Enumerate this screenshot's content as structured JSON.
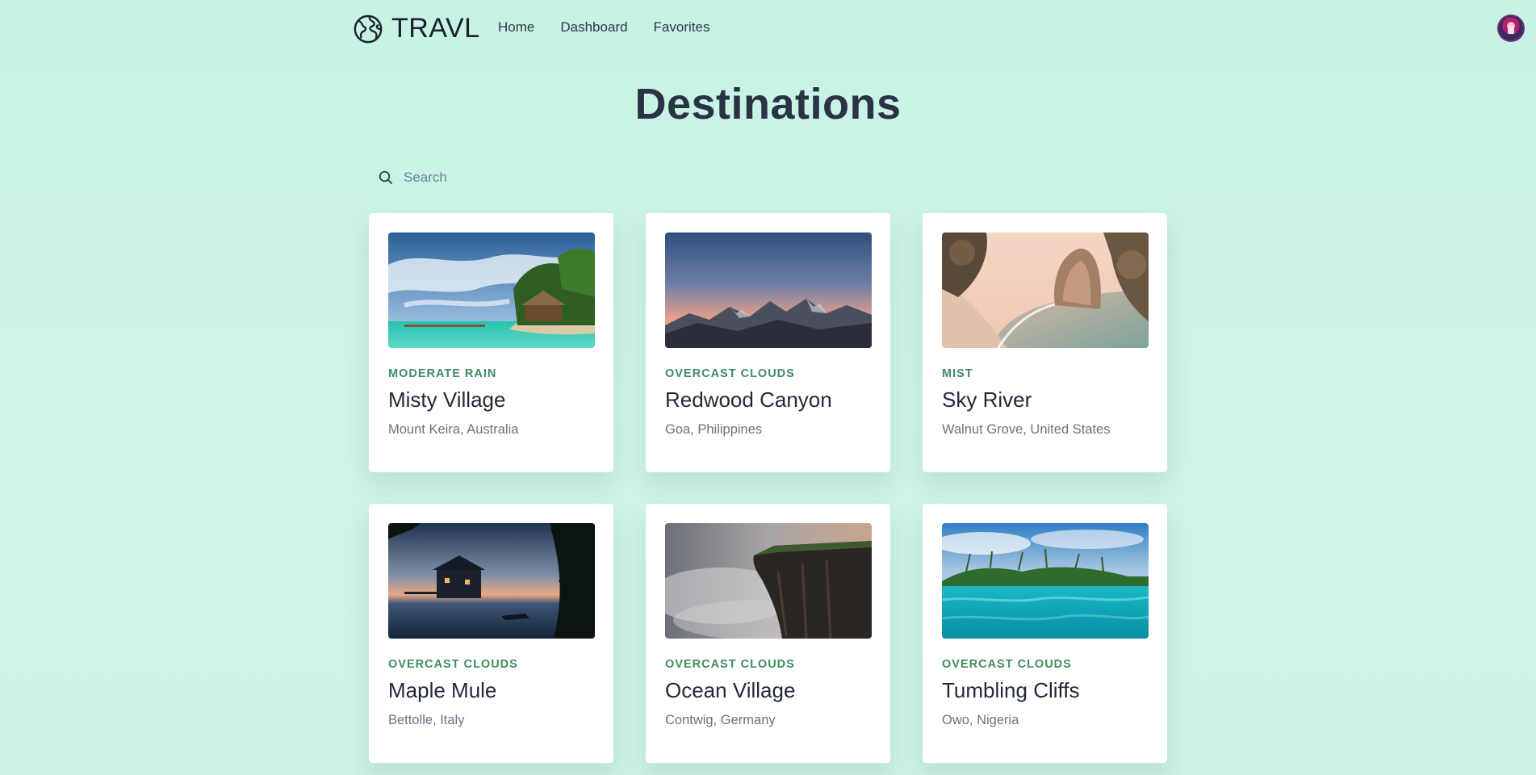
{
  "app": {
    "logo_text": "TRAVL"
  },
  "nav": {
    "items": [
      "Home",
      "Dashboard",
      "Favorites"
    ]
  },
  "page": {
    "title": "Destinations"
  },
  "search": {
    "placeholder": "Search",
    "value": ""
  },
  "destinations": [
    {
      "weather": "MODERATE RAIN",
      "name": "Misty Village",
      "location": "Mount Keira, Australia",
      "image": "tropical-beach-hut"
    },
    {
      "weather": "OVERCAST CLOUDS",
      "name": "Redwood Canyon",
      "location": "Goa, Philippines",
      "image": "mountain-range-sunset"
    },
    {
      "weather": "MIST",
      "name": "Sky River",
      "location": "Walnut Grove, United States",
      "image": "cove-beach-rock"
    },
    {
      "weather": "OVERCAST CLOUDS",
      "name": "Maple Mule",
      "location": "Bettolle, Italy",
      "image": "stilt-house-dusk"
    },
    {
      "weather": "OVERCAST CLOUDS",
      "name": "Ocean Village",
      "location": "Contwig, Germany",
      "image": "foggy-cliff"
    },
    {
      "weather": "OVERCAST CLOUDS",
      "name": "Tumbling Cliffs",
      "location": "Owo, Nigeria",
      "image": "turquoise-island"
    }
  ],
  "colors": {
    "background": "#c6f3e4",
    "weather_label": "#3f8b62",
    "title": "#2a3246"
  }
}
